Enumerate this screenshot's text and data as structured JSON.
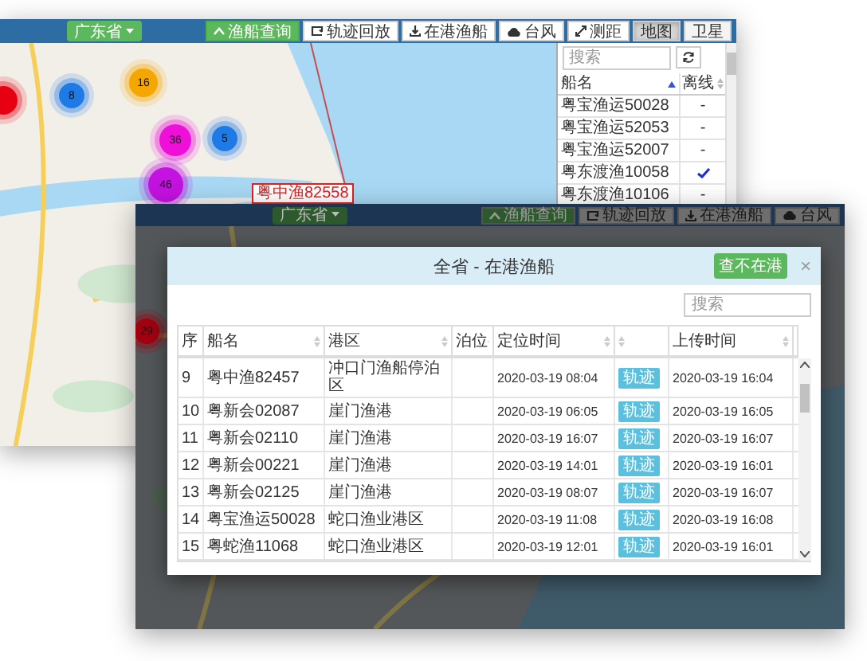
{
  "back_window": {
    "toolbar": {
      "region": "广东省",
      "buttons": [
        {
          "kind": "primary",
          "label": "渔船查询"
        },
        {
          "kind": "tool",
          "label": "轨迹回放"
        },
        {
          "kind": "tool",
          "label": "在港渔船"
        },
        {
          "kind": "tool",
          "label": "台风"
        },
        {
          "kind": "tool",
          "label": "测距"
        },
        {
          "kind": "toggle",
          "label": "地图",
          "selected": true
        },
        {
          "kind": "toggle",
          "label": "卫星",
          "selected": false
        }
      ]
    },
    "map": {
      "clusters": [
        {
          "count": "16",
          "color": "#f5a700"
        },
        {
          "count": "8",
          "color": "#1e7be6"
        },
        {
          "count": "36",
          "color": "#ee10d8"
        },
        {
          "count": "5",
          "color": "#1e7be6"
        },
        {
          "count": "46",
          "color": "#c412e0"
        },
        {
          "color": "#e60012"
        }
      ],
      "ship_label": "粤中渔82558"
    },
    "ship_panel": {
      "search": {
        "placeholder": "搜索"
      },
      "columns": [
        "船名",
        "离线"
      ],
      "rows": [
        {
          "name": "粤宝渔运50028",
          "offline": false,
          "mark": "-"
        },
        {
          "name": "粤宝渔运52053",
          "offline": false,
          "mark": "-"
        },
        {
          "name": "粤宝渔运52007",
          "offline": false,
          "mark": "-"
        },
        {
          "name": "粤东渡渔10058",
          "offline": true
        },
        {
          "name": "粤东渡渔10106",
          "offline": false,
          "mark": "-"
        }
      ]
    }
  },
  "front_window": {
    "toolbar": {
      "region": "广东省",
      "buttons": [
        {
          "kind": "primary",
          "label": "渔船查询"
        },
        {
          "kind": "tool",
          "label": "轨迹回放"
        },
        {
          "kind": "tool",
          "label": "在港渔船"
        },
        {
          "kind": "tool",
          "label": "台风"
        }
      ]
    },
    "map": {
      "clusters": [
        {
          "count": "29",
          "color": "#a30010"
        }
      ]
    },
    "modal": {
      "title": "全省 - 在港渔船",
      "action": "查不在港",
      "close": "×",
      "search": {
        "placeholder": "搜索"
      },
      "columns": [
        "序",
        "船名",
        "港区",
        "泊位",
        "定位时间",
        "",
        "上传时间"
      ],
      "rows": [
        {
          "no": "9",
          "name": "粤中渔82457",
          "port": "冲口门渔船停泊区",
          "located": "2020-03-19 08:04",
          "track": "轨迹",
          "uploaded": "2020-03-19 16:04"
        },
        {
          "no": "10",
          "name": "粤新会02087",
          "port": "崖门渔港",
          "located": "2020-03-19 06:05",
          "track": "轨迹",
          "uploaded": "2020-03-19 16:05"
        },
        {
          "no": "11",
          "name": "粤新会02110",
          "port": "崖门渔港",
          "located": "2020-03-19 16:07",
          "track": "轨迹",
          "uploaded": "2020-03-19 16:07"
        },
        {
          "no": "12",
          "name": "粤新会00221",
          "port": "崖门渔港",
          "located": "2020-03-19 14:01",
          "track": "轨迹",
          "uploaded": "2020-03-19 16:01"
        },
        {
          "no": "13",
          "name": "粤新会02125",
          "port": "崖门渔港",
          "located": "2020-03-19 08:07",
          "track": "轨迹",
          "uploaded": "2020-03-19 16:07"
        },
        {
          "no": "14",
          "name": "粤宝渔运50028",
          "port": "蛇口渔业港区",
          "located": "2020-03-19 11:08",
          "track": "轨迹",
          "uploaded": "2020-03-19 16:08"
        },
        {
          "no": "15",
          "name": "粤蛇渔11068",
          "port": "蛇口渔业港区",
          "located": "2020-03-19 12:01",
          "track": "轨迹",
          "uploaded": "2020-03-19 16:01"
        }
      ]
    }
  }
}
